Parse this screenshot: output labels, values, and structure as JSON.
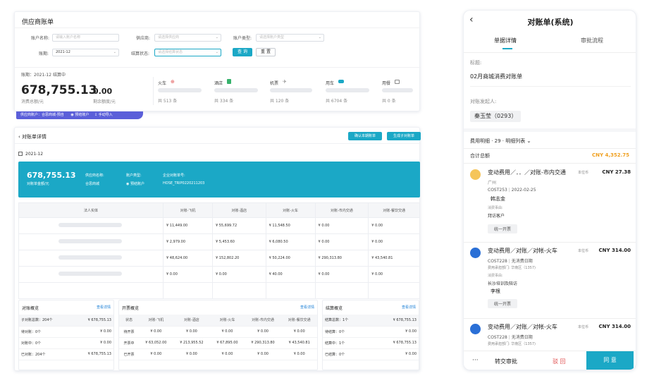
{
  "supplier_bill": {
    "title": "供应商账单",
    "filters": {
      "account_name_label": "账户名称:",
      "account_name_placeholder": "请输入账户名称",
      "supplier_label": "供应商:",
      "supplier_placeholder": "请选择供应商",
      "account_type_label": "账户类型:",
      "account_type_placeholder": "请选择账户类型",
      "period_label": "账期:",
      "period_value": "2021-12",
      "settle_label": "结算状态:",
      "settle_placeholder": "请选择结算状态",
      "query_button": "查 询",
      "reset_button": "重 置"
    },
    "summary": {
      "period_status": "账期：2021-12 结算中",
      "total_amount": "678,755.13",
      "total_label": "消费总额/元",
      "remaining_amount": "0.00",
      "remaining_label": "剩余额度/元",
      "categories": [
        {
          "name": "火车",
          "icon": "train-icon",
          "count": "共 513 条"
        },
        {
          "name": "酒店",
          "icon": "hotel-icon",
          "count": "共 334 条"
        },
        {
          "name": "机票",
          "icon": "plane-icon",
          "count": "共 120 条"
        },
        {
          "name": "用车",
          "icon": "car-icon",
          "count": "共 6704 条"
        },
        {
          "name": "用餐",
          "icon": "meal-icon",
          "count": "共 0 条"
        }
      ],
      "tags": [
        "供应商账户：合思商城-预自",
        "预结账户",
        "手动导入"
      ]
    }
  },
  "detail": {
    "back_label": "对账单详情",
    "confirm_button": "确认本期账单",
    "generate_button": "生成子对账单",
    "period": "2021-12",
    "banner": {
      "amount": "678,755.13",
      "amount_label": "对账单金额/元",
      "supplier_label": "供应商名称:",
      "supplier_value": "合思商城",
      "type_label": "账户类型:",
      "type_value": "预结账户",
      "enterprise_label": "企业对账单号:",
      "enterprise_value": "HOSE_TRIP0220211203"
    },
    "table": {
      "headers": [
        "法人实体",
        "对账-飞机",
        "对账-酒店",
        "对账-火车",
        "对账-市内交通",
        "对账-餐饮交通"
      ],
      "rows": [
        [
          "",
          "¥ 11,449.00",
          "¥ 55,699.72",
          "¥ 11,548.50",
          "¥ 0.00",
          "¥ 0.00"
        ],
        [
          "",
          "¥ 2,979.00",
          "¥ 5,453.60",
          "¥ 6,080.50",
          "¥ 0.00",
          "¥ 0.00"
        ],
        [
          "",
          "¥ 48,624.00",
          "¥ 152,802.20",
          "¥ 50,224.00",
          "¥ 290,313.80",
          "¥ 43,540.81"
        ],
        [
          "",
          "¥ 0.00",
          "¥ 0.00",
          "¥ 40.00",
          "¥ 0.00",
          "¥ 0.00"
        ],
        [
          "",
          "",
          "",
          "",
          "",
          ""
        ]
      ]
    },
    "recon": {
      "title": "对账概览",
      "link": "查看详情",
      "rows": [
        [
          "子对账总数：204个",
          "¥ 678,755.13"
        ],
        [
          "待对账：0个",
          "¥ 0.00"
        ],
        [
          "对账中：0个",
          "¥ 0.00"
        ],
        [
          "已对账：204个",
          "¥ 678,755.13"
        ]
      ]
    },
    "invoice": {
      "title": "开票概览",
      "link": "查看详情",
      "headers": [
        "状态",
        "对账-飞机",
        "对账-酒店",
        "对账-火车",
        "对账-市内交通",
        "对账-餐饮交通"
      ],
      "rows": [
        [
          "待开票",
          "¥ 0.00",
          "¥ 0.00",
          "¥ 0.00",
          "¥ 0.00",
          "¥ 0.00"
        ],
        [
          "开票中",
          "¥ 63,052.00",
          "¥ 213,955.52",
          "¥ 67,895.00",
          "¥ 290,313.80",
          "¥ 43,540.81"
        ],
        [
          "已开票",
          "¥ 0.00",
          "¥ 0.00",
          "¥ 0.00",
          "¥ 0.00",
          "¥ 0.00"
        ]
      ]
    },
    "settle": {
      "title": "结算概览",
      "link": "查看详情",
      "rows": [
        [
          "结算总数：1个",
          "¥ 678,755.13"
        ],
        [
          "待结算：0个",
          "¥ 0.00"
        ],
        [
          "结算中：1个",
          "¥ 678,755.13"
        ],
        [
          "已结算：0个",
          "¥ 0.00"
        ]
      ]
    }
  },
  "mobile": {
    "title": "对账单(系统)",
    "tabs": [
      "单据详情",
      "审批流程"
    ],
    "subject_label": "标题:",
    "subject_value": "02月商城消费对账单",
    "initiator_label": "对账发起人:",
    "initiator_value": "秦玉莹（0293）",
    "detail_header": "费用明细 · 29 · 明细列表",
    "total_label": "合计总额",
    "total_value": "CNY 4,352.75",
    "items": [
      {
        "title": "变动费用／．．／对账-市内交通",
        "unit": "本位币",
        "amount": "CNY 27.38",
        "city": "广州",
        "code": "COST253",
        "date": "2022-02-25",
        "person": "韩志金",
        "reason_label": "消费事由:",
        "reason": "拜访客户",
        "button": "统一开票"
      },
      {
        "title": "变动费用／对账／对帐-火车",
        "unit": "本位币",
        "amount": "CNY 314.00",
        "code": "COST228",
        "date": "无消费日期",
        "dept": "费用承担部门: 华南区（1357)",
        "reason_label": "消费事由:",
        "reason": "长沙培训及陪访",
        "person": "李根",
        "button": "统一开票"
      },
      {
        "title": "变动费用／对账／对帐-火车",
        "unit": "本位币",
        "amount": "CNY 314.00",
        "code": "COST228",
        "date": "无消费日期",
        "dept": "费用承担部门: 华南区（1357)"
      }
    ],
    "footer": {
      "more": "···",
      "transfer": "转交审批",
      "reject": "驳 回",
      "approve": "同 意"
    }
  },
  "colors": {
    "accent": "#1ba8c6",
    "purple": "#5b5fd9",
    "orange": "#f0a020",
    "blue": "#2a6fd6"
  }
}
